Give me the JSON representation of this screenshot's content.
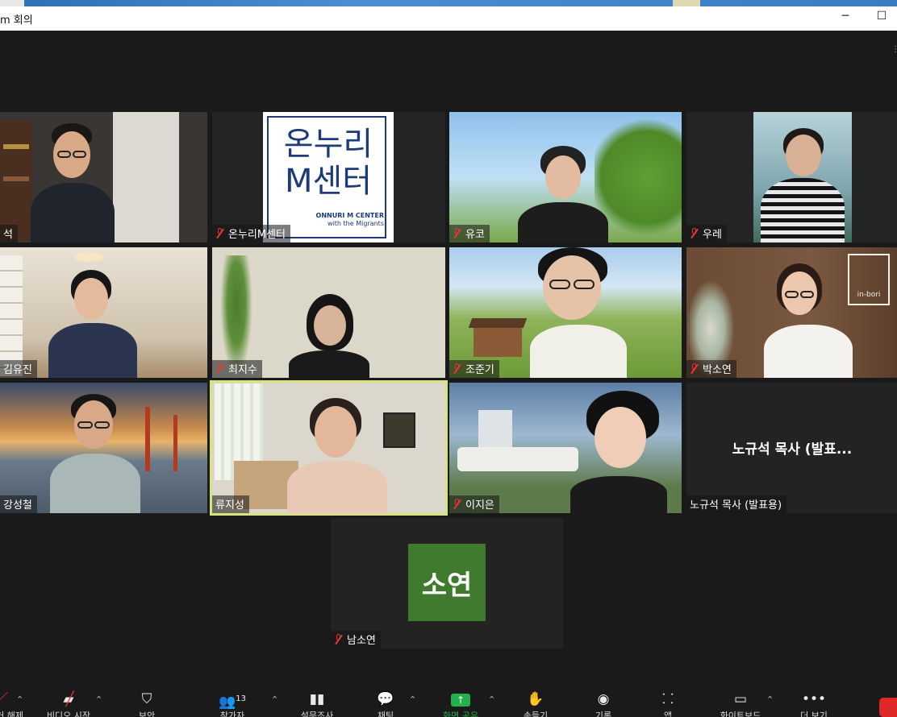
{
  "window": {
    "title": "m 회의",
    "minimize": "─",
    "maximize": "☐"
  },
  "participants": [
    {
      "name": "석",
      "muted": false
    },
    {
      "name": "온누리M센터",
      "muted": true
    },
    {
      "name": "유코",
      "muted": true
    },
    {
      "name": "우레",
      "muted": true
    },
    {
      "name": "김유진",
      "muted": false
    },
    {
      "name": "최지수",
      "muted": true
    },
    {
      "name": "조준기",
      "muted": true
    },
    {
      "name": "박소연",
      "muted": true
    },
    {
      "name": "강성철",
      "muted": false
    },
    {
      "name": "류지성",
      "muted": false
    },
    {
      "name": "이지은",
      "muted": true
    },
    {
      "name": "노규석 목사 (발표용)",
      "muted": false
    },
    {
      "name": "남소연",
      "muted": true
    }
  ],
  "logo_tile": {
    "line1": "온누리",
    "line2": "M센터",
    "sub1": "ONNURI M CENTER",
    "sub2": "with the Migrants"
  },
  "inbori_text": "in-bori",
  "name_card": "노규석 목사 (발표...",
  "avatar_initials": "소연",
  "toolbar": {
    "participants_count": "13",
    "items": [
      "음소거 해제",
      "비디오 시작",
      "보안",
      "참가자",
      "설문조사",
      "채팅",
      "화면 공유",
      "손들기",
      "기록",
      "앱",
      "화이트보드",
      "더 보기"
    ]
  },
  "colors": {
    "active_speaker": "#d7e37d",
    "avatar_bg": "#3f7a2e",
    "share_green": "#22b14c",
    "end_red": "#e02828"
  }
}
